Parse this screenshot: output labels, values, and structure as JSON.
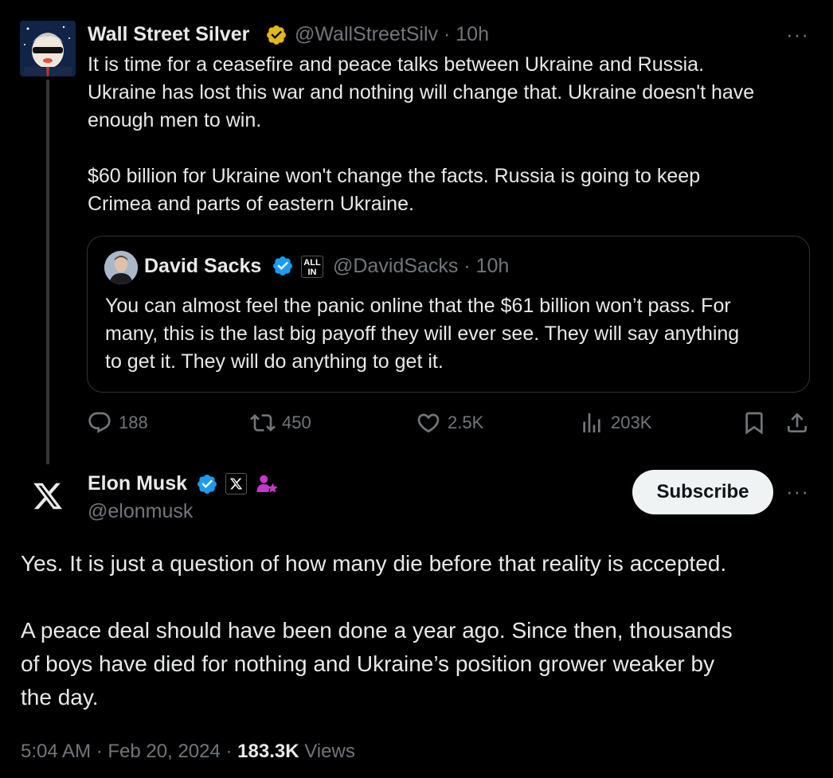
{
  "quoted_by": {
    "name": "Wall Street Silver",
    "handle": "@WallStreetSilv",
    "time": "· 10h",
    "text_p1": "It is time for a ceasefire and peace talks between Ukraine and Russia.",
    "text_p1b": "Ukraine has lost this war and nothing will change that. Ukraine doesn't have",
    "text_p1c": "enough men to win.",
    "text_p2a": "$60 billion for Ukraine won't change the facts. Russia is going to keep",
    "text_p2b": "Crimea and parts of eastern Ukraine.",
    "verified_color": "#e2b719"
  },
  "quote": {
    "name": "David Sacks",
    "badge": "ALL IN",
    "handle": "@DavidSacks",
    "time": "· 10h",
    "line1": "You can almost feel the panic online that the $61 billion won’t pass. For",
    "line2": "many, this is the last big payoff they will ever see. They will say anything",
    "line3": "to get it. They will do anything to get it."
  },
  "actions": {
    "replies": "188",
    "reposts": "450",
    "likes": "2.5K",
    "views": "203K"
  },
  "main": {
    "name": "Elon Musk",
    "handle": "@elonmusk",
    "subscribe_label": "Subscribe",
    "p1": "Yes. It is just a question of how many die before that reality is accepted.",
    "p2a": "A peace deal should have been done a year ago. Since then, thousands",
    "p2b": "of boys have died for nothing and Ukraine’s position grower weaker by",
    "p2c": "the day.",
    "time": "5:04 AM",
    "date": "· Feb 20, 2024 ·",
    "views_count": "183.3K",
    "views_label": "Views",
    "verified_color": "#1d9bf0"
  },
  "icons": [
    "more-icon",
    "verified-gold-icon",
    "verified-blue-icon",
    "reply-icon",
    "repost-icon",
    "like-icon",
    "views-icon",
    "bookmark-icon",
    "share-icon",
    "x-logo-icon",
    "subscriber-icon"
  ]
}
